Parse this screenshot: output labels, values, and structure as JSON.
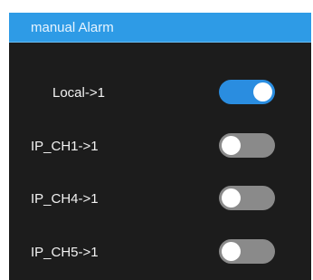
{
  "dialog": {
    "title": "manual Alarm"
  },
  "alarms": [
    {
      "label": "Local->1",
      "enabled": true
    },
    {
      "label": "IP_CH1->1",
      "enabled": false
    },
    {
      "label": "IP_CH4->1",
      "enabled": false
    },
    {
      "label": "IP_CH5->1",
      "enabled": false
    }
  ],
  "colors": {
    "title_bar": "#2e9be6",
    "panel": "#1c1c1c",
    "toggle_on": "#2a8de0",
    "toggle_off": "#8a8a8a"
  }
}
